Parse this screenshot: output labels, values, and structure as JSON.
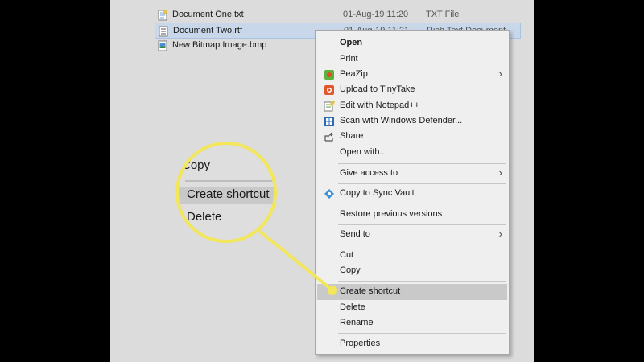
{
  "files": [
    {
      "name": "Document One.txt",
      "date": "01-Aug-19 11:20",
      "type": "TXT File",
      "icon": "notepad-file-icon",
      "selected": false
    },
    {
      "name": "Document Two.rtf",
      "date": "01-Aug-19 11:21",
      "type": "Rich Text Document",
      "icon": "rtf-file-icon",
      "selected": true
    },
    {
      "name": "New Bitmap Image.bmp",
      "date": "",
      "type": "",
      "icon": "bitmap-file-icon",
      "selected": false
    }
  ],
  "context_menu": {
    "open": "Open",
    "print": "Print",
    "peazip": "PeaZip",
    "upload_tinytake": "Upload to TinyTake",
    "edit_notepadpp": "Edit with Notepad++",
    "scan_defender": "Scan with Windows Defender...",
    "share": "Share",
    "open_with": "Open with...",
    "give_access": "Give access to",
    "copy_sync_vault": "Copy to Sync Vault",
    "restore_versions": "Restore previous versions",
    "send_to": "Send to",
    "cut": "Cut",
    "copy": "Copy",
    "create_shortcut": "Create shortcut",
    "delete": "Delete",
    "rename": "Rename",
    "properties": "Properties"
  },
  "magnifier": {
    "copy": "Copy",
    "create_shortcut": "Create shortcut",
    "delete": "Delete"
  },
  "colors": {
    "highlight": "#f2e65a",
    "selection": "#c8d8ea"
  }
}
